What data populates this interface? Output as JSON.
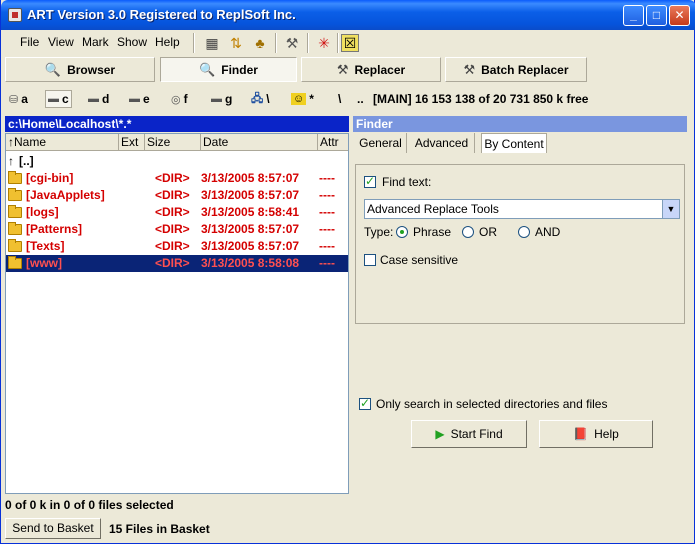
{
  "window": {
    "title": "ART Version 3.0 Registered to ReplSoft Inc."
  },
  "menu": {
    "items": [
      "File",
      "View",
      "Mark",
      "Show",
      "Help"
    ]
  },
  "modes": {
    "browser": "Browser",
    "finder": "Finder",
    "replacer": "Replacer",
    "batch_replacer": "Batch Replacer"
  },
  "drives": [
    {
      "letter": "a"
    },
    {
      "letter": "c"
    },
    {
      "letter": "d"
    },
    {
      "letter": "e"
    },
    {
      "letter": "f"
    },
    {
      "letter": "g"
    },
    {
      "letter": "\\"
    },
    {
      "letter": "*"
    },
    {
      "letter": "\\"
    },
    {
      "letter": ".."
    }
  ],
  "disk_info": "[MAIN]  16 153 138 of 20 731 850 k free",
  "file_pane": {
    "path": "c:\\Home\\Localhost\\*.*",
    "columns": [
      "↑Name",
      "Ext",
      "Size",
      "Date",
      "Attr"
    ],
    "rows": [
      {
        "name": "[..]",
        "size": "",
        "date": "",
        "attr": ""
      },
      {
        "name": "[cgi-bin]",
        "size": "<DIR>",
        "date": "3/13/2005 8:57:07",
        "attr": "----"
      },
      {
        "name": "[JavaApplets]",
        "size": "<DIR>",
        "date": "3/13/2005 8:57:07",
        "attr": "----"
      },
      {
        "name": "[logs]",
        "size": "<DIR>",
        "date": "3/13/2005 8:58:41",
        "attr": "----"
      },
      {
        "name": "[Patterns]",
        "size": "<DIR>",
        "date": "3/13/2005 8:57:07",
        "attr": "----"
      },
      {
        "name": "[Texts]",
        "size": "<DIR>",
        "date": "3/13/2005 8:57:07",
        "attr": "----"
      },
      {
        "name": "[www]",
        "size": "<DIR>",
        "date": "3/13/2005 8:58:08",
        "attr": "----"
      }
    ],
    "status": "0 of 0 k in 0 of 0 files selected"
  },
  "basket": {
    "button": "Send to Basket",
    "status": "15 Files in Basket"
  },
  "finder": {
    "header": "Finder",
    "tabs": [
      "General",
      "Advanced",
      "By Content"
    ],
    "find_text_label": "Find text:",
    "find_text_value": "Advanced Replace Tools",
    "type_label": "Type:",
    "type_options": [
      "Phrase",
      "OR",
      "AND"
    ],
    "case_sensitive_label": "Case sensitive",
    "only_selected_label": "Only search in selected directories and files",
    "start_button": "Start Find",
    "help_button": "Help"
  }
}
